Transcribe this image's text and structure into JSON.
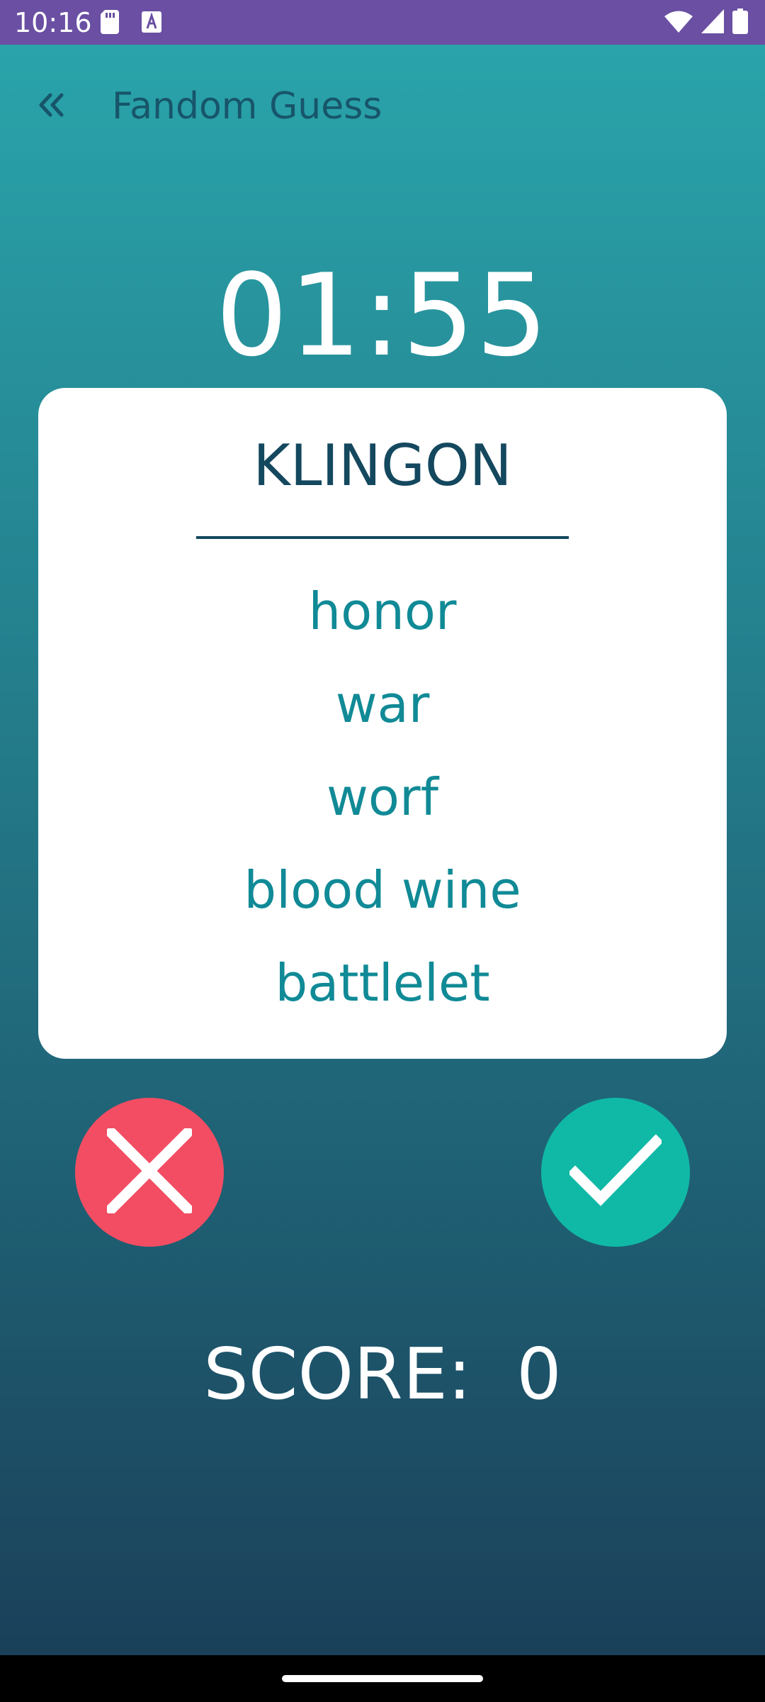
{
  "status_bar": {
    "time": "10:16",
    "icons": [
      "sd-card-icon",
      "text-a-icon",
      "wifi-icon",
      "cellular-signal-icon",
      "battery-icon"
    ]
  },
  "toolbar": {
    "back_icon": "double-chevron-left-icon",
    "title": "Fandom Guess"
  },
  "timer": {
    "value": "01:55"
  },
  "card": {
    "title": "KLINGON",
    "words": [
      "honor",
      "war",
      "worf",
      "blood wine",
      "battlelet"
    ]
  },
  "actions": {
    "wrong_icon": "close-icon",
    "correct_icon": "checkmark-icon"
  },
  "score": {
    "text": "SCORE:  0"
  },
  "colors": {
    "status_bar": "#6a4fa3",
    "gradient_top": "#2aa6ac",
    "gradient_bottom": "#1a3d57",
    "wrong_button": "#f24d63",
    "correct_button": "#10b9a6",
    "card_title": "#14485e",
    "word_text": "#108a96"
  }
}
